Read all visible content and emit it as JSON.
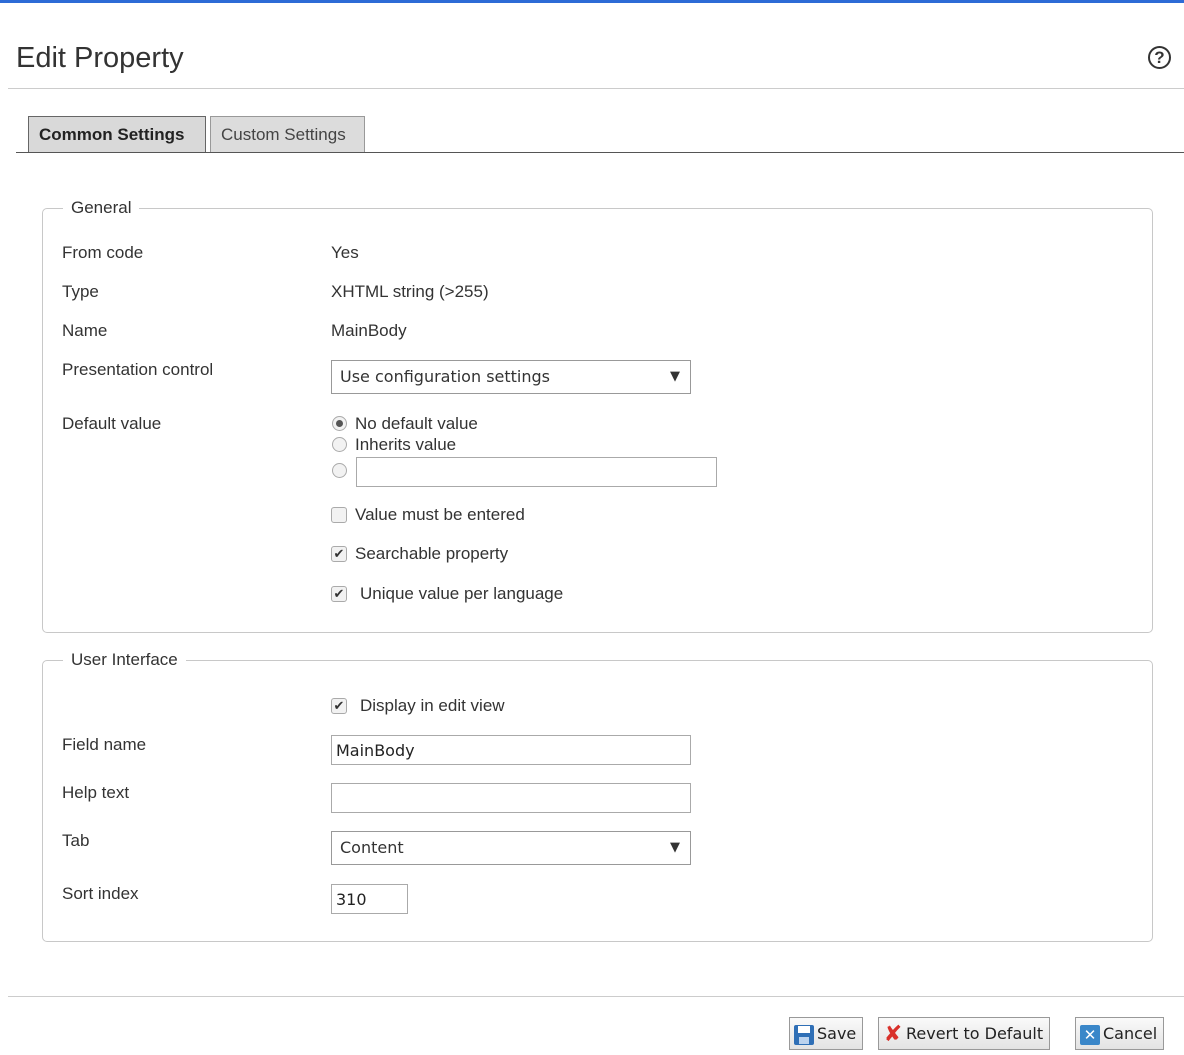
{
  "header": {
    "title": "Edit Property",
    "help_icon": "question-circle-icon"
  },
  "tabs": [
    {
      "label": "Common Settings",
      "active": true
    },
    {
      "label": "Custom Settings",
      "active": false
    }
  ],
  "general": {
    "legend": "General",
    "from_code": {
      "label": "From code",
      "value": "Yes"
    },
    "type": {
      "label": "Type",
      "value": "XHTML string (>255)"
    },
    "name": {
      "label": "Name",
      "value": "MainBody"
    },
    "presentation_control": {
      "label": "Presentation control",
      "selected": "Use configuration settings"
    },
    "default_value": {
      "label": "Default value",
      "options": [
        "No default value",
        "Inherits value"
      ],
      "selected_index": 0,
      "custom_value": ""
    },
    "checkboxes": [
      {
        "label": "Value must be entered",
        "checked": false
      },
      {
        "label": "Searchable property",
        "checked": true
      },
      {
        "label": "Unique value per language",
        "checked": true
      }
    ]
  },
  "ui": {
    "legend": "User Interface",
    "display_in_edit_view": {
      "label": "Display in edit view",
      "checked": true
    },
    "field_name": {
      "label": "Field name",
      "value": "MainBody"
    },
    "help_text": {
      "label": "Help text",
      "value": ""
    },
    "tab": {
      "label": "Tab",
      "selected": "Content"
    },
    "sort_index": {
      "label": "Sort index",
      "value": "310"
    }
  },
  "footer": {
    "save_label": "Save",
    "revert_label": "Revert to Default",
    "cancel_label": "Cancel"
  },
  "colors": {
    "accent": "#2d6bd6",
    "revert_icon": "#d9302a",
    "save_icon": "#2f6fb6"
  }
}
